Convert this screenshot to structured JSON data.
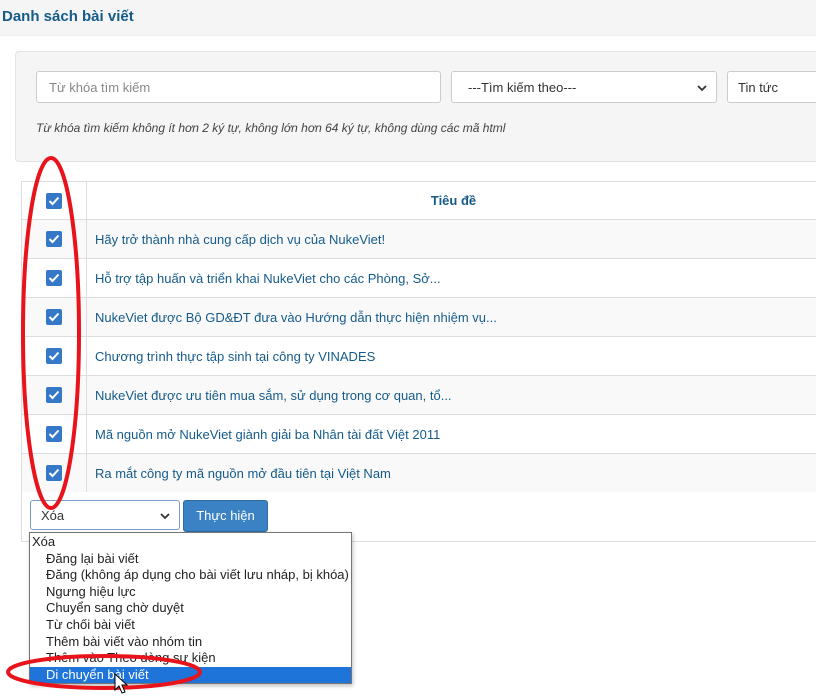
{
  "page": {
    "title": "Danh sách bài viết"
  },
  "search": {
    "placeholder": "Từ khóa tìm kiếm",
    "search_by_value": "---Tìm kiếm theo---",
    "category_value": "Tin tức",
    "hint": "Từ khóa tìm kiếm không ít hơn 2 ký tự, không lớn hơn 64 ký tự, không dùng các mã html"
  },
  "table": {
    "header_title": "Tiêu đề",
    "rows": [
      {
        "title": "Hãy trở thành nhà cung cấp dịch vụ của NukeViet!",
        "checked": true
      },
      {
        "title": "Hỗ trợ tập huấn và triển khai NukeViet cho các Phòng, Sở...",
        "checked": true
      },
      {
        "title": "NukeViet được Bộ GD&ĐT đưa vào Hướng dẫn thực hiện nhiệm vụ...",
        "checked": true
      },
      {
        "title": "Chương trình thực tập sinh tại công ty VINADES",
        "checked": true
      },
      {
        "title": "NukeViet được ưu tiên mua sắm, sử dụng trong cơ quan, tổ...",
        "checked": true
      },
      {
        "title": "Mã nguồn mở NukeViet giành giải ba Nhân tài đất Việt 2011",
        "checked": true
      },
      {
        "title": "Ra mắt công ty mã nguồn mở đầu tiên tại Việt Nam",
        "checked": true
      }
    ]
  },
  "action": {
    "selected": "Xóa",
    "run_label": "Thực hiện",
    "options": [
      "Xóa",
      "Đăng lại bài viết",
      "Đăng (không áp dụng cho bài viết lưu nháp, bị khóa)",
      "Ngưng hiệu lực",
      "Chuyển sang chờ duyệt",
      "Từ chối bài viết",
      "Thêm bài viết vào nhóm tin",
      "Thêm vào Theo dòng sự kiện",
      "Di chuyển bài viết"
    ],
    "highlighted_index": 8
  },
  "colors": {
    "accent": "#155b8a",
    "checkbox": "#3478c7",
    "button": "#3a82c4",
    "highlight": "#1e74d8",
    "annotation": "#e8131b"
  }
}
